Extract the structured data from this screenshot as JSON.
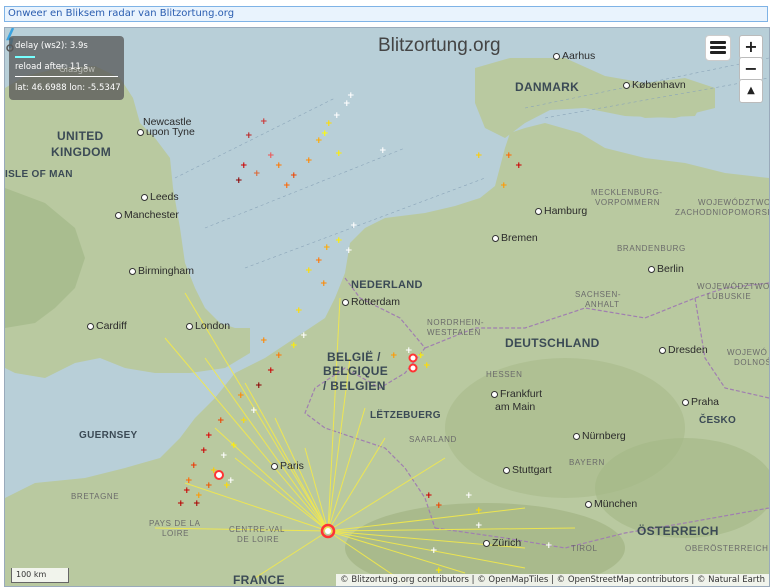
{
  "header": {
    "title": "Onweer en Bliksem radar van Blitzortung.org"
  },
  "brand": {
    "name": "Blitzortung.org"
  },
  "info_panel": {
    "delay": "delay (ws2): 3.9s",
    "reload": "reload after: 11 s",
    "coords": "lat: 46.6988 lon: -5.5347",
    "ghost_text": "Glasgow"
  },
  "controls": {
    "zoom_in": "+",
    "zoom_out": "−",
    "compass": "▲"
  },
  "map": {
    "countries": [
      "UNITED",
      "KINGDOM",
      "ISLE OF MAN",
      "DANMARK",
      "NEDERLAND",
      "BELGIË /",
      "BELGIQUE",
      "/ BELGIEN",
      "DEUTSCHLAND",
      "LËTZEBUERG",
      "FRANCE",
      "GUERNSEY",
      "ÖSTERREICH",
      "ČESKO"
    ],
    "regions": [
      "MECKLENBURG-",
      "VORPOMMERN",
      "WOJEWÓDZTWO",
      "ZACHODNIOPOMORSKIE",
      "BRANDENBURG",
      "SACHSEN-",
      "ANHALT",
      "WOJEWÓDZTWO",
      "LUBUSKIE",
      "NORDRHEIN-",
      "WESTFALEN",
      "HESSEN",
      "SAARLAND",
      "BAYERN",
      "BRETAGNE",
      "PAYS DE LA",
      "LOIRE",
      "CENTRE-VAL",
      "DE LOIRE",
      "WOJEWÓ",
      "DOLNOŚ",
      "TIROL",
      "OBERÖSTERREICH"
    ],
    "cities": [
      "Aarhus",
      "København",
      "Newcastle",
      "upon Tyne",
      "Leeds",
      "Manchester",
      "Hamburg",
      "Bremen",
      "Berlin",
      "Birmingham",
      "Cardiff",
      "London",
      "Rotterdam",
      "Dresden",
      "Frankfurt",
      "am Main",
      "Praha",
      "Nürnberg",
      "Stuttgart",
      "Paris",
      "München",
      "Zürich"
    ]
  },
  "scale": {
    "label": "100 km"
  },
  "attribution": "© Blitzortung.org contributors | © OpenMapTiles | © OpenStreetMap contributors | © Natural Earth",
  "colors": {
    "sea": "#b8cfd8",
    "land": "#b9c9a0",
    "accent": "#2a5db0",
    "strike_recent": "#ffffff",
    "strike_old": "#8b0000",
    "station_line": "#f4ea4a"
  }
}
